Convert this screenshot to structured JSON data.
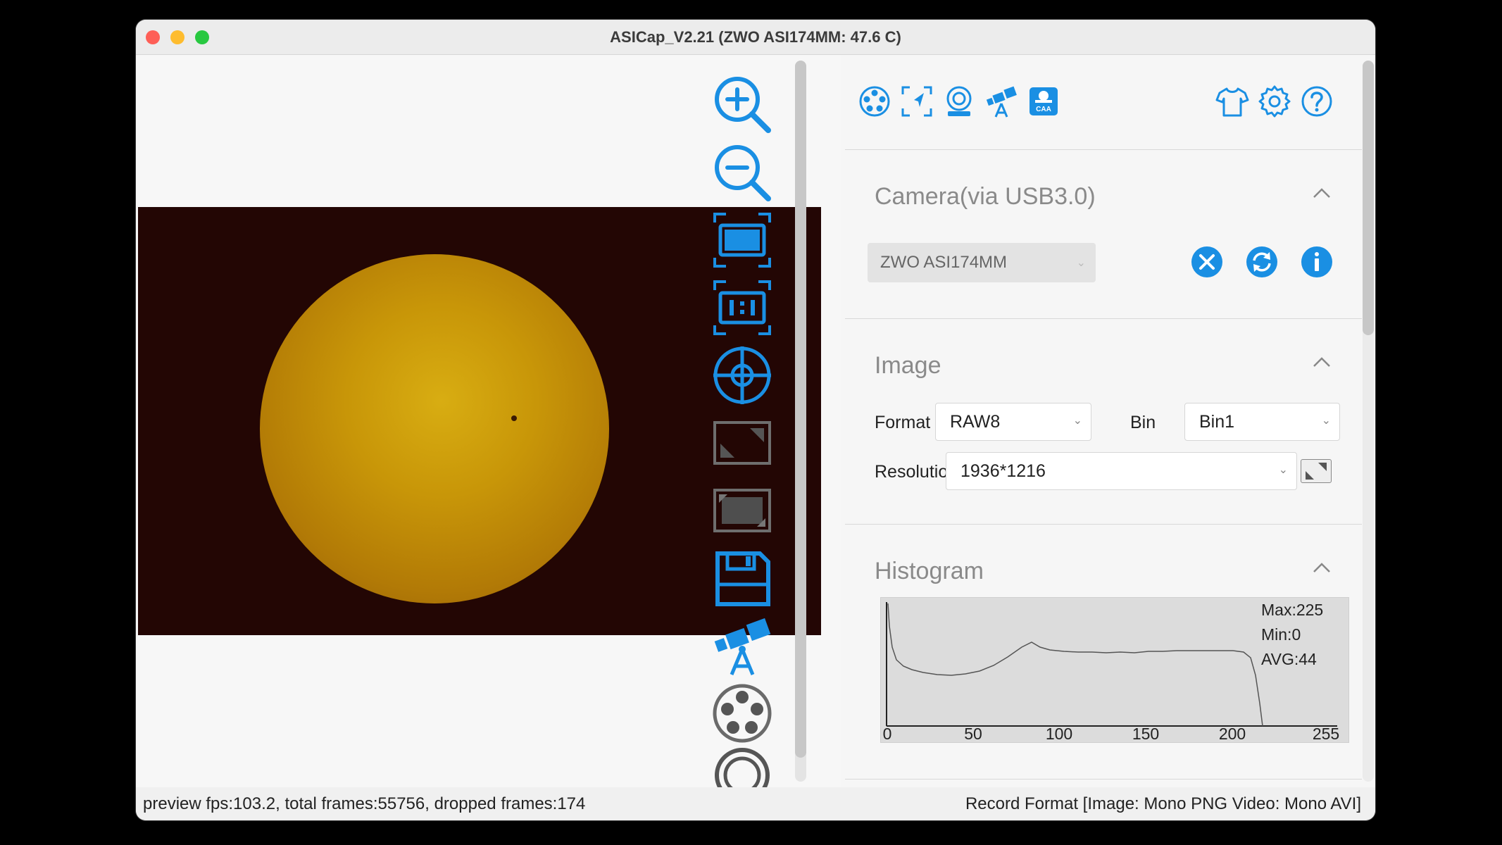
{
  "window": {
    "title": "ASICap_V2.21 (ZWO ASI174MM: 47.6 C)"
  },
  "colors": {
    "accent": "#1a8fe3",
    "sun": "#c89608",
    "preview_bg": "#230604"
  },
  "toolbar_left": {
    "icons": [
      "zoom-in-icon",
      "zoom-out-icon",
      "fit-window-icon",
      "actual-size-icon",
      "crosshair-icon",
      "roi-icon",
      "full-frame-icon",
      "save-icon",
      "telescope-icon",
      "filter-wheel-icon",
      "focuser-icon"
    ]
  },
  "toolbar_top": {
    "icons": [
      "filter-wheel-icon",
      "guide-icon",
      "focuser-icon",
      "telescope-icon",
      "caa-icon",
      "skin-icon",
      "settings-icon",
      "help-icon"
    ],
    "caa_label": "CAA"
  },
  "camera": {
    "title": "Camera(via USB3.0)",
    "selected": "ZWO ASI174MM"
  },
  "image": {
    "title": "Image",
    "format_label": "Format",
    "format_value": "RAW8",
    "bin_label": "Bin",
    "bin_value": "Bin1",
    "resolution_label": "Resolution",
    "resolution_value": "1936*1216"
  },
  "histogram": {
    "title": "Histogram",
    "max": "Max:225",
    "min": "Min:0",
    "avg": "AVG:44",
    "ticks": [
      "0",
      "50",
      "100",
      "150",
      "200",
      "255"
    ]
  },
  "status": {
    "left": "preview fps:103.2, total frames:55756, dropped frames:174",
    "right": "Record Format [Image: Mono PNG Video: Mono AVI]"
  }
}
